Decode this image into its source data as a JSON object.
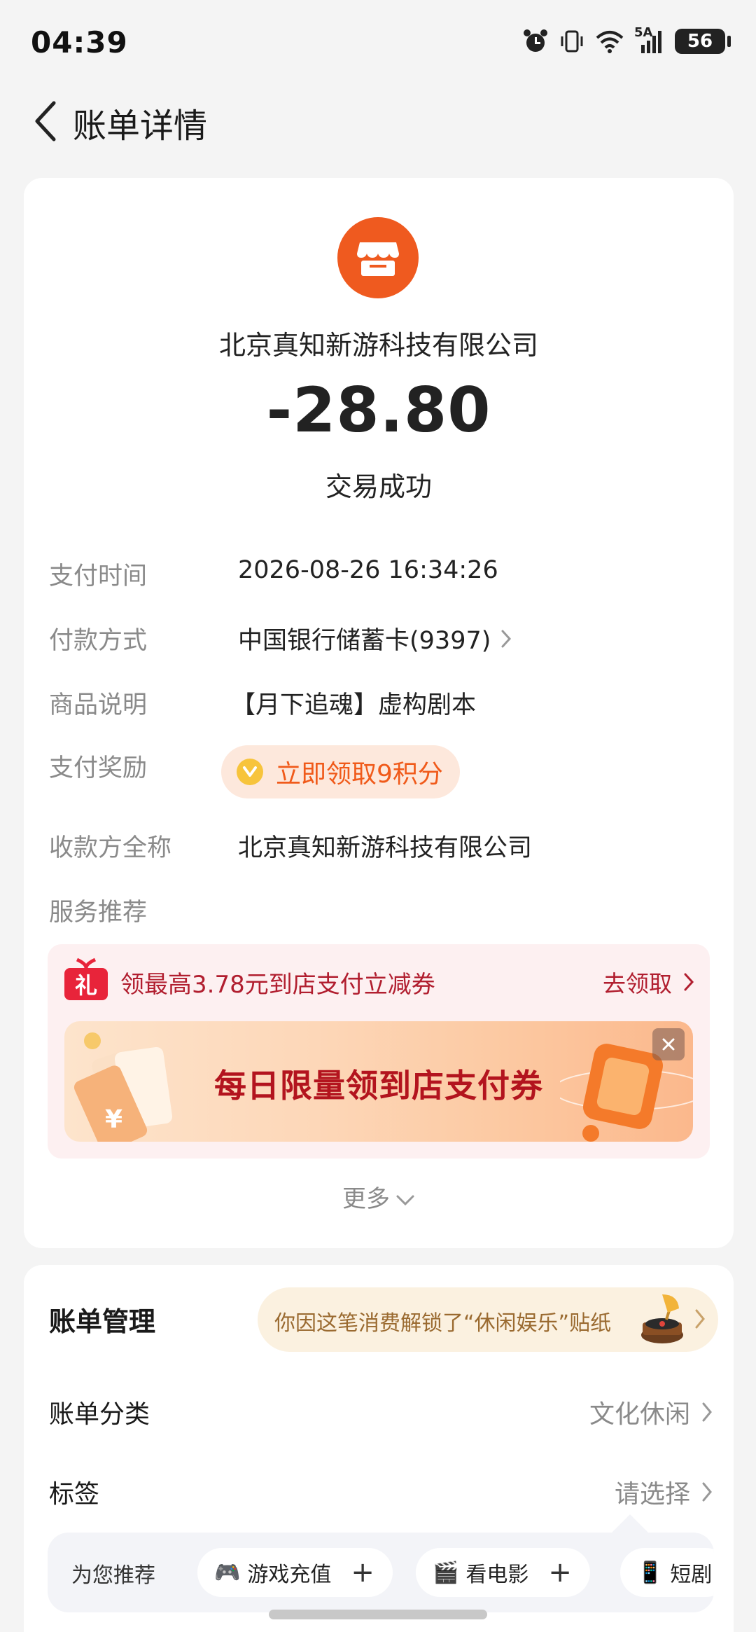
{
  "status_bar": {
    "time": "04:39",
    "battery": "56",
    "network": "5A"
  },
  "header": {
    "title": "账单详情"
  },
  "transaction": {
    "merchant": "北京真知新游科技有限公司",
    "amount": "-28.80",
    "status": "交易成功"
  },
  "details": {
    "pay_time_label": "支付时间",
    "pay_time_value": "2026-08-26 16:34:26",
    "pay_method_label": "付款方式",
    "pay_method_value": "中国银行储蓄卡(9397)",
    "goods_label": "商品说明",
    "goods_value": "【月下追魂】虚构剧本",
    "reward_label": "支付奖励",
    "reward_value": "立即领取9积分",
    "payee_label": "收款方全称",
    "payee_value": "北京真知新游科技有限公司",
    "service_label": "服务推荐"
  },
  "promo": {
    "title": "领最高3.78元到店支付立减券",
    "link": "去领取",
    "banner_text": "每日限量领到店支付券",
    "gift_char": "礼"
  },
  "more": {
    "label": "更多"
  },
  "manage": {
    "title": "账单管理",
    "sticker_text": "你因这笔消费解锁了“休闲娱乐”贴纸",
    "category_label": "账单分类",
    "category_value": "文化休闲",
    "tag_label": "标签",
    "tag_value": "请选择"
  },
  "recommend": {
    "label": "为您推荐",
    "chips": [
      {
        "icon": "🎮",
        "label": "游戏充值"
      },
      {
        "icon": "🎬",
        "label": "看电影"
      },
      {
        "icon": "📱",
        "label": "短剧"
      }
    ]
  },
  "colors": {
    "accent_orange": "#ef5a1f",
    "promo_red": "#b11e2f",
    "reward_orange": "#f05a1a"
  }
}
